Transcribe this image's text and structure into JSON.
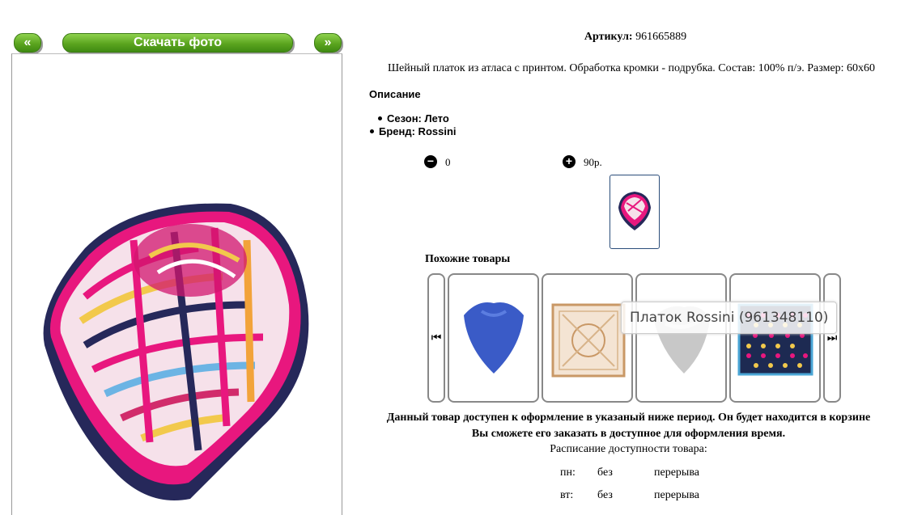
{
  "nav": {
    "prev_label": "«",
    "download_label": "Скачать фото",
    "next_label": "»"
  },
  "product": {
    "article_label": "Артикул:",
    "article_value": "961665889",
    "description": "Шейный платок из атласа с принтом. Обработка кромки - подрубка. Состав: 100% п/э. Размер: 60х60",
    "description_heading": "Описание",
    "season": "Сезон: Лето",
    "brand": "Бренд: Rossini"
  },
  "quantity": {
    "minus_icon": "minus-circle-icon",
    "plus_icon": "plus-circle-icon",
    "value": "0",
    "price": "90р."
  },
  "similar": {
    "title": "Похожие товары",
    "prev_icon": "skip-back-icon",
    "next_icon": "skip-forward-icon",
    "items": [
      {
        "color": "#3a5bc7"
      },
      {
        "color": "#c99866"
      },
      {
        "color": "#c8c8c8"
      },
      {
        "color": "#1d2a52"
      }
    ],
    "tooltip": "Платок Rossini (961348110)"
  },
  "notice": {
    "line1": "Данный товар доступен к оформление в указаный ниже период. Он будет находится в корзине",
    "line2": "Вы сможете его заказать в доступное для оформления время."
  },
  "schedule": {
    "title": "Расписание доступности товара:",
    "rows": [
      {
        "day": "пн:",
        "from": "без",
        "to": "перерыва"
      },
      {
        "day": "вт:",
        "from": "без",
        "to": "перерыва"
      }
    ]
  },
  "colors": {
    "green_button": "#5ba51f",
    "scarf_pink": "#e8177e",
    "scarf_navy": "#26285a"
  }
}
